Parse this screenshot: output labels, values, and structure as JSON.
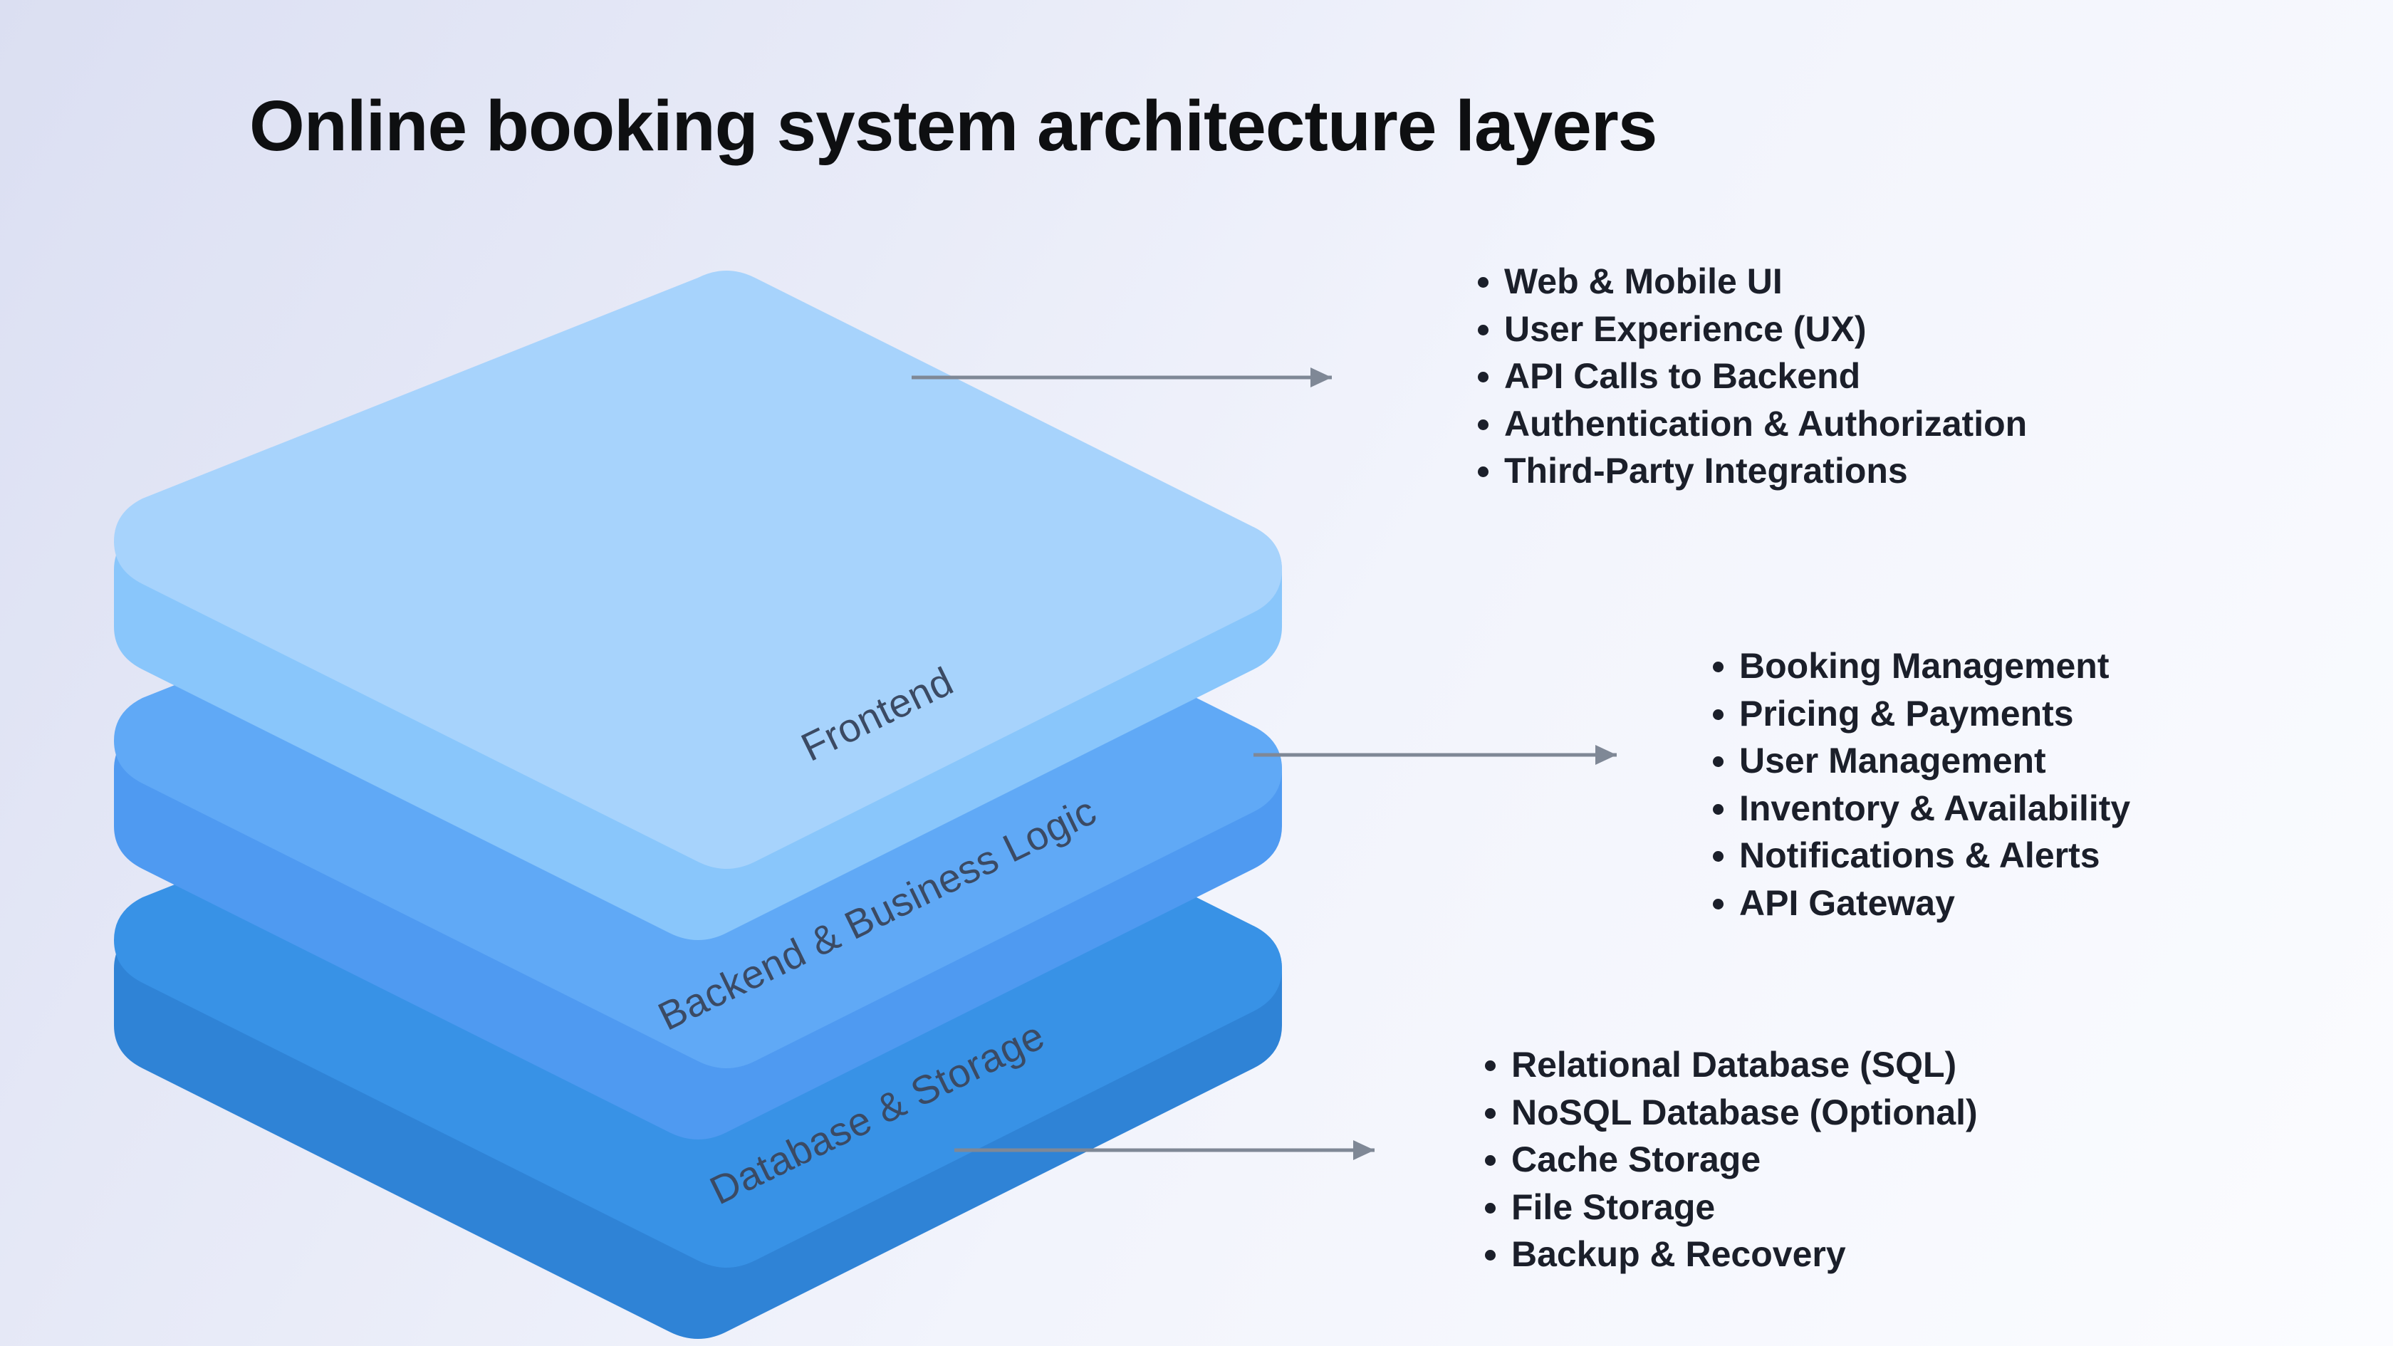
{
  "title": "Online booking system architecture layers",
  "layers": [
    {
      "name": "Frontend",
      "items": [
        "Web & Mobile UI",
        "User Experience (UX)",
        "API Calls to Backend",
        "Authentication & Authorization",
        "Third-Party Integrations"
      ]
    },
    {
      "name": "Backend & Business Logic",
      "items": [
        "Booking Management",
        "Pricing & Payments",
        "User Management",
        "Inventory & Availability",
        "Notifications & Alerts",
        "API Gateway"
      ]
    },
    {
      "name": "Database & Storage",
      "items": [
        "Relational Database (SQL)",
        "NoSQL Database (Optional)",
        "Cache Storage",
        "File Storage",
        "Backup & Recovery"
      ]
    }
  ],
  "colors": {
    "layer_top": [
      "#a7d3fc",
      "#60a9f6",
      "#3892e6"
    ],
    "layer_side": [
      "#89c6fb",
      "#4f9af1",
      "#2f83d6"
    ],
    "arrow": "#7f8896",
    "text": "#1b1f2a"
  }
}
